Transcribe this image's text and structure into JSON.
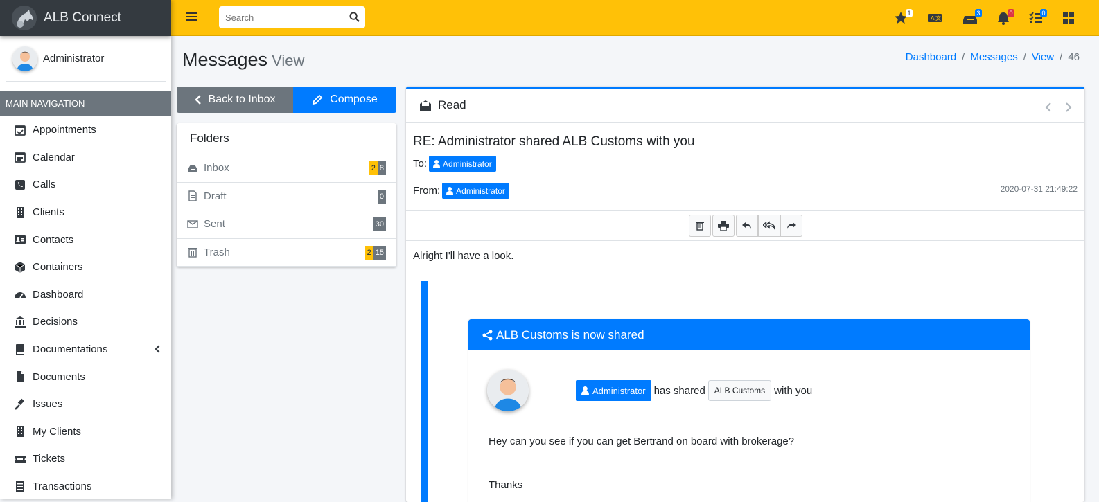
{
  "app": {
    "name": "ALB Connect"
  },
  "sidebar": {
    "user": "Administrator",
    "nav_header": "MAIN NAVIGATION",
    "items": [
      {
        "label": "Appointments",
        "icon": "calendar-check-icon"
      },
      {
        "label": "Calendar",
        "icon": "calendar-icon"
      },
      {
        "label": "Calls",
        "icon": "phone-icon"
      },
      {
        "label": "Clients",
        "icon": "building-icon"
      },
      {
        "label": "Contacts",
        "icon": "address-card-icon"
      },
      {
        "label": "Containers",
        "icon": "cube-icon"
      },
      {
        "label": "Dashboard",
        "icon": "gauge-icon"
      },
      {
        "label": "Decisions",
        "icon": "landmark-icon"
      },
      {
        "label": "Documentations",
        "icon": "book-icon"
      },
      {
        "label": "Documents",
        "icon": "file-icon"
      },
      {
        "label": "Issues",
        "icon": "gavel-icon"
      },
      {
        "label": "My Clients",
        "icon": "building-icon"
      },
      {
        "label": "Tickets",
        "icon": "ticket-icon"
      },
      {
        "label": "Transactions",
        "icon": "receipt-icon"
      }
    ]
  },
  "topbar": {
    "search_placeholder": "Search",
    "badges": {
      "favorites": "1",
      "inbox": "3",
      "notifications": "0",
      "tasks": "0"
    }
  },
  "page": {
    "title": "Messages",
    "subtitle": "View"
  },
  "breadcrumb": [
    "Dashboard",
    "Messages",
    "View",
    "46"
  ],
  "buttons": {
    "back": "Back to Inbox",
    "compose": "Compose"
  },
  "folders": {
    "title": "Folders",
    "items": [
      {
        "label": "Inbox",
        "badges": [
          "2",
          "8"
        ]
      },
      {
        "label": "Draft",
        "badges": [
          "0"
        ]
      },
      {
        "label": "Sent",
        "badges": [
          "30"
        ]
      },
      {
        "label": "Trash",
        "badges": [
          "2",
          "15"
        ]
      }
    ]
  },
  "message": {
    "header": "Read",
    "subject": "RE: Administrator shared ALB Customs with you",
    "to_label": "To:",
    "to": "Administrator",
    "from_label": "From:",
    "from": "Administrator",
    "date": "2020-07-31 21:49:22",
    "body": "Alright I'll have a look.",
    "quoted": {
      "title": "ALB Customs is now shared",
      "user": "Administrator",
      "text_mid": "has shared",
      "item": "ALB Customs",
      "text_end": "with you",
      "body": "Hey can you see if you can get Bertrand on board with brokerage?",
      "signoff": "Thanks"
    }
  },
  "colors": {
    "topbar": "#ffc107",
    "primary": "#007bff",
    "sidebar_brand": "#343a40",
    "secondary": "#6c757d"
  }
}
